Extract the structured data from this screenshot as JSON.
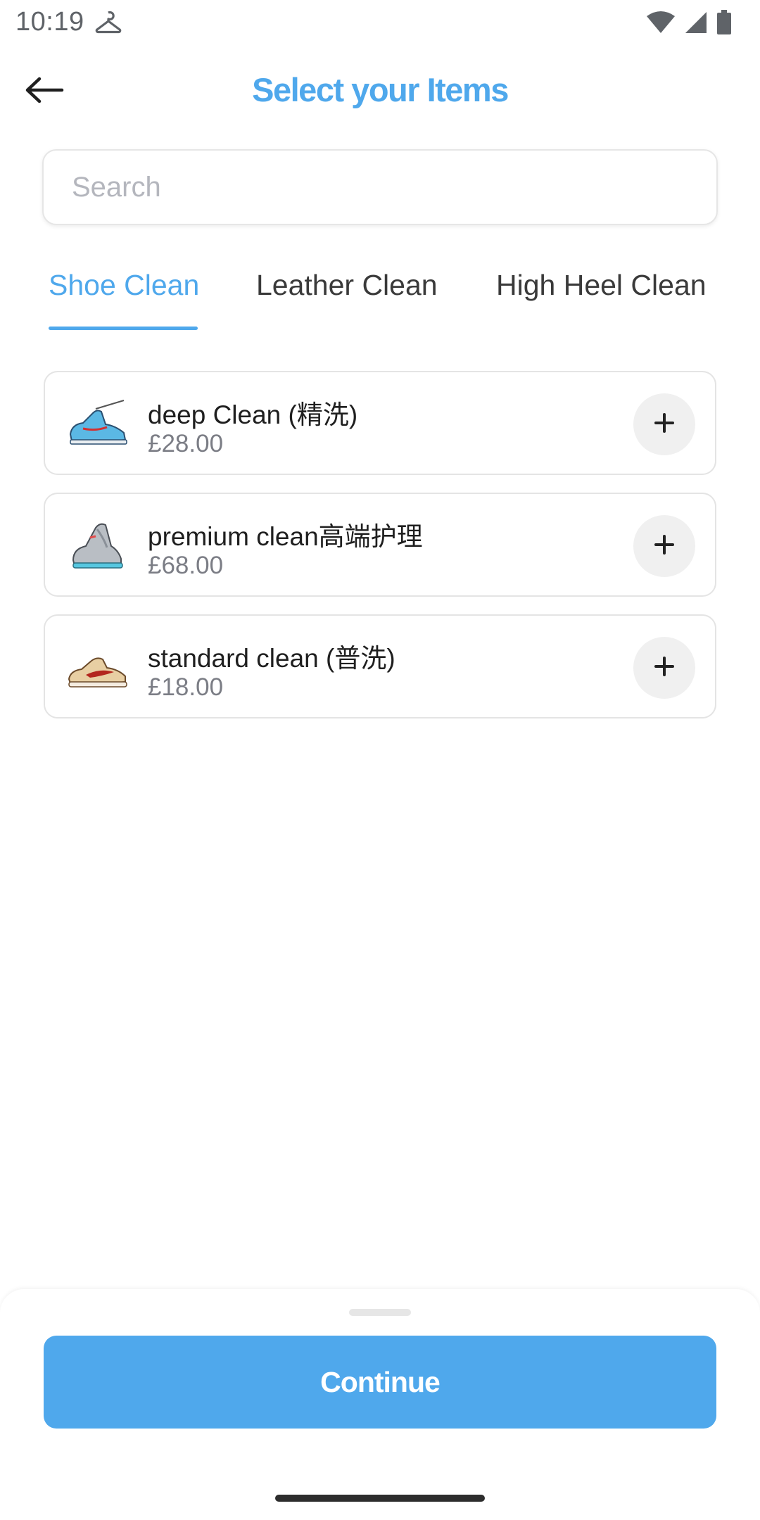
{
  "status_bar": {
    "time": "10:19"
  },
  "header": {
    "title": "Select your Items"
  },
  "search": {
    "placeholder": "Search",
    "value": ""
  },
  "tabs": [
    {
      "label": "Shoe Clean",
      "active": true
    },
    {
      "label": "Leather Clean",
      "active": false
    },
    {
      "label": "High Heel Clean",
      "active": false
    }
  ],
  "items": [
    {
      "name": "deep Clean (精洗)",
      "price": "£28.00",
      "icon": "sneaker-blue-icon"
    },
    {
      "name": "premium clean高端护理",
      "price": "£68.00",
      "icon": "sneaker-grey-icon"
    },
    {
      "name": "standard clean (普洗)",
      "price": "£18.00",
      "icon": "sneaker-tan-icon"
    }
  ],
  "footer": {
    "continue_label": "Continue"
  },
  "colors": {
    "accent": "#4fa8ec",
    "add_button_bg": "#f0f0f0"
  }
}
